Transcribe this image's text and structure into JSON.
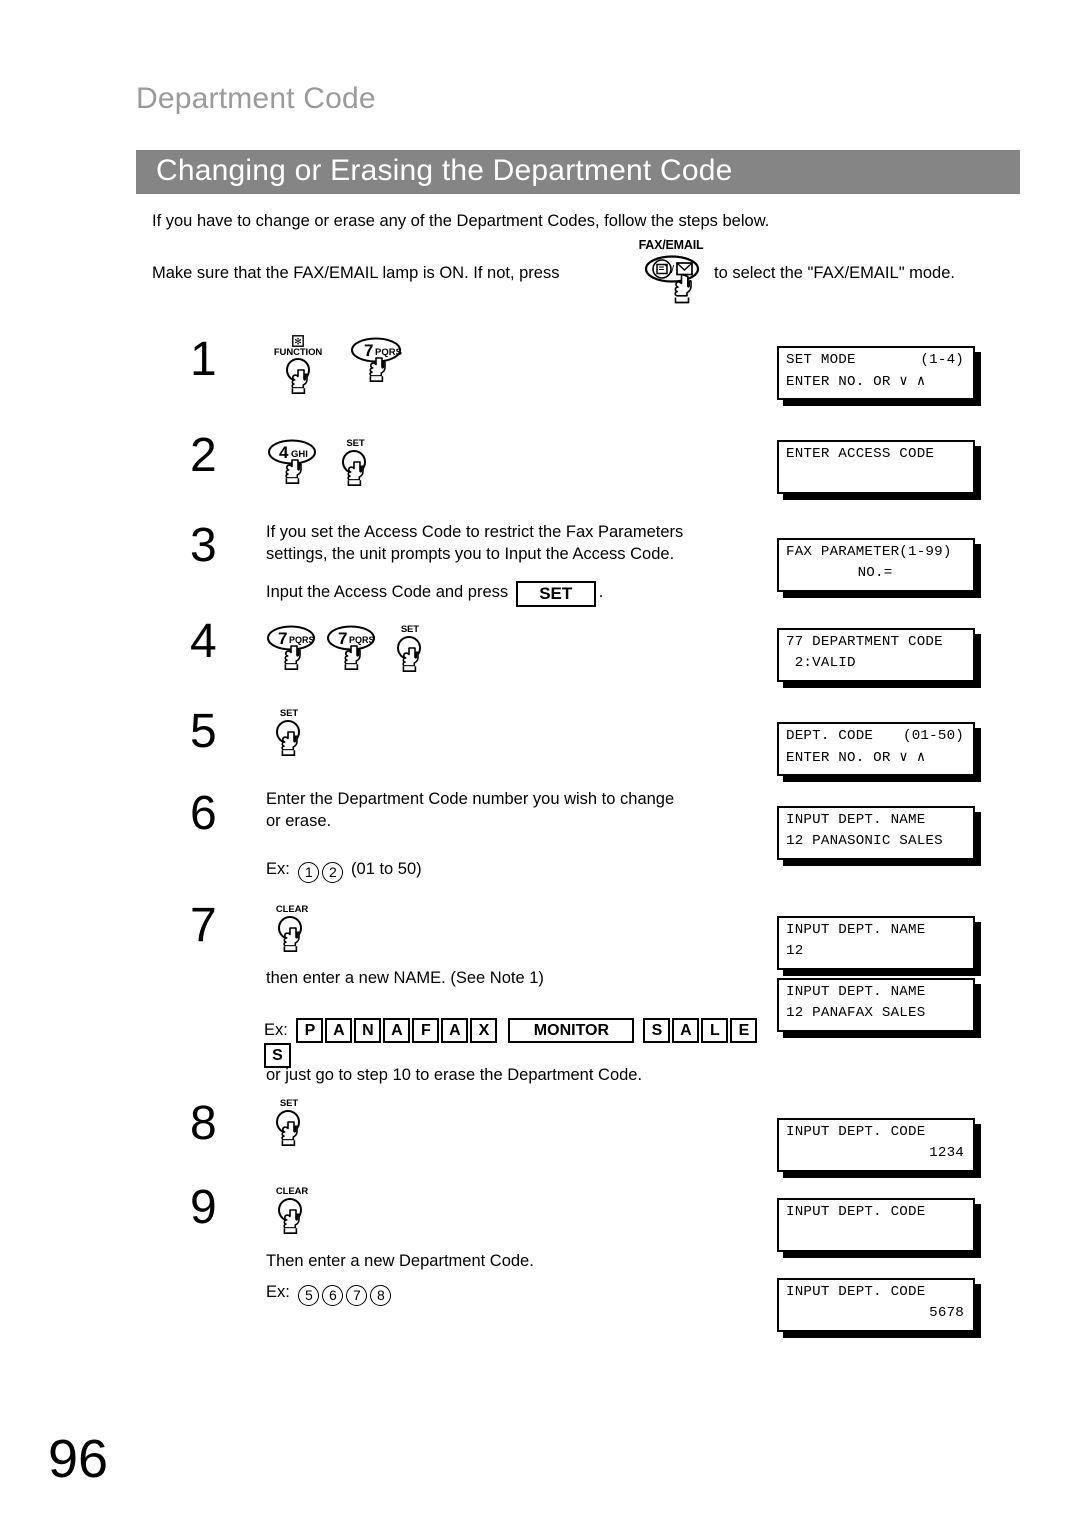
{
  "document": {
    "chapter_title": "Department Code",
    "section_title": "Changing or Erasing the Department Code",
    "page_number": "96",
    "colors": {
      "section_bar": "#858585",
      "chapter_title": "#9b9b9b",
      "text": "#000000"
    }
  },
  "intro": {
    "line1": "If you have to change or erase any of the Department Codes, follow the steps below.",
    "line2_before": "Make sure that the FAX/EMAIL lamp is ON.  If not, press",
    "line2_after": "to select the \"FAX/EMAIL\" mode.",
    "faxemail_key_label": "FAX/EMAIL"
  },
  "steps": [
    {
      "number": "1",
      "keys": [
        {
          "type": "round",
          "cap": "FUNCTION",
          "glyph": "asterisk-box"
        },
        {
          "type": "oval",
          "digit": "7",
          "letters": "PQRS"
        }
      ]
    },
    {
      "number": "2",
      "keys": [
        {
          "type": "oval",
          "digit": "4",
          "letters": "GHI"
        },
        {
          "type": "round",
          "cap": "SET"
        }
      ]
    },
    {
      "number": "3",
      "text_line1": "If you set the Access Code to restrict the Fax Parameters",
      "text_line2": "settings, the unit prompts you to Input the Access Code.",
      "text_line3_before": "Input the Access Code and press",
      "text_line3_key": "SET",
      "text_line3_after": "."
    },
    {
      "number": "4",
      "keys": [
        {
          "type": "oval",
          "digit": "7",
          "letters": "PQRS"
        },
        {
          "type": "oval",
          "digit": "7",
          "letters": "PQRS"
        },
        {
          "type": "round",
          "cap": "SET"
        }
      ]
    },
    {
      "number": "5",
      "keys": [
        {
          "type": "round",
          "cap": "SET"
        }
      ]
    },
    {
      "number": "6",
      "text_line1": "Enter the Department Code number you wish to change",
      "text_line2": "or erase.",
      "example_prefix": "Ex:",
      "example_digits": [
        "1",
        "2"
      ],
      "example_suffix": "(01 to 50)"
    },
    {
      "number": "7",
      "keys": [
        {
          "type": "round",
          "cap": "CLEAR"
        }
      ],
      "text_line1": "then enter a new NAME. (See Note 1)",
      "example_prefix": "Ex:",
      "example_keys": [
        "P",
        "A",
        "N",
        "A",
        "F",
        "A",
        "X"
      ],
      "example_wide_key": "MONITOR",
      "example_keys2": [
        "S",
        "A",
        "L",
        "E",
        "S"
      ],
      "text_line2": "or just go to step 10 to erase the Department Code."
    },
    {
      "number": "8",
      "keys": [
        {
          "type": "round",
          "cap": "SET"
        }
      ]
    },
    {
      "number": "9",
      "keys": [
        {
          "type": "round",
          "cap": "CLEAR"
        }
      ],
      "text_line1": "Then enter a new Department Code.",
      "example_prefix": "Ex:",
      "example_digits": [
        "5",
        "6",
        "7",
        "8"
      ]
    }
  ],
  "lcd_displays": [
    {
      "id": "lcd-1",
      "line1_left": "SET MODE",
      "line1_right": "(1-4)",
      "line2_left": "ENTER NO. OR ∨ ∧"
    },
    {
      "id": "lcd-2",
      "line1_left": "ENTER ACCESS CODE",
      "line2_left": ""
    },
    {
      "id": "lcd-3",
      "line1_left": "FAX PARAMETER(1-99)",
      "line2_center": "NO.="
    },
    {
      "id": "lcd-4",
      "line1_left": "77 DEPARTMENT CODE",
      "line2_left": " 2:VALID"
    },
    {
      "id": "lcd-5",
      "line1_left": "DEPT. CODE",
      "line1_right": "(01-50)",
      "line2_left": "ENTER NO. OR ∨ ∧"
    },
    {
      "id": "lcd-6",
      "line1_left": "INPUT DEPT. NAME",
      "line2_left": "12 PANASONIC SALES"
    },
    {
      "id": "lcd-7",
      "line1_left": "INPUT DEPT. NAME",
      "line2_left": "12"
    },
    {
      "id": "lcd-8",
      "line1_left": "INPUT DEPT. NAME",
      "line2_left": "12 PANAFAX SALES"
    },
    {
      "id": "lcd-9",
      "line1_left": "INPUT DEPT. CODE",
      "line2_right": "1234"
    },
    {
      "id": "lcd-10",
      "line1_left": "INPUT DEPT. CODE",
      "line2_left": ""
    },
    {
      "id": "lcd-11",
      "line1_left": "INPUT DEPT. CODE",
      "line2_right": "5678"
    }
  ]
}
